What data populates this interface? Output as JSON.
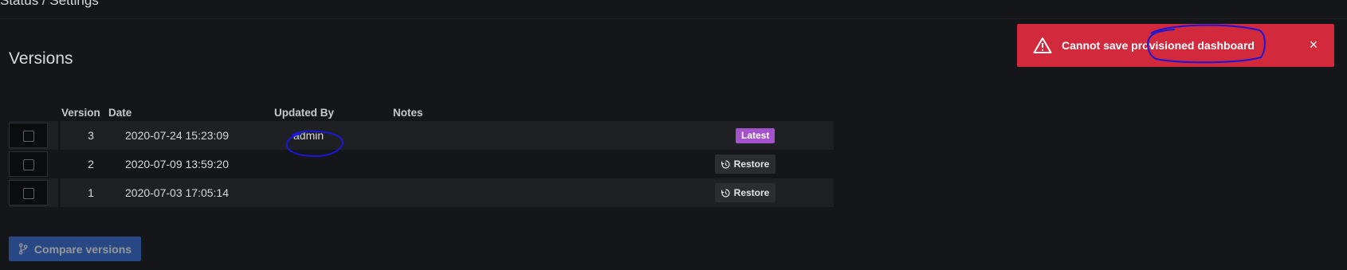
{
  "header": {
    "breadcrumb": "Status / Settings"
  },
  "page": {
    "title": "Versions"
  },
  "table": {
    "columns": {
      "version": "Version",
      "date": "Date",
      "updated_by": "Updated By",
      "notes": "Notes"
    },
    "rows": [
      {
        "version": "3",
        "date": "2020-07-24 15:23:09",
        "updated_by": "admin",
        "notes": "",
        "badge": "Latest"
      },
      {
        "version": "2",
        "date": "2020-07-09 13:59:20",
        "updated_by": "",
        "notes": "",
        "action": "Restore"
      },
      {
        "version": "1",
        "date": "2020-07-03 17:05:14",
        "updated_by": "",
        "notes": "",
        "action": "Restore"
      }
    ]
  },
  "compare": {
    "label": "Compare versions"
  },
  "toast": {
    "message": "Cannot save provisioned dashboard",
    "close": "×"
  },
  "icons": {
    "restore": "history-icon",
    "compare": "code-branch-icon",
    "warning": "exclamation-triangle-icon",
    "close": "times-icon"
  },
  "colors": {
    "background": "#141619",
    "latest_badge": "#a352cc",
    "toast": "#d2293d",
    "primary": "#3871dc",
    "annotation": "#1a17d6"
  }
}
